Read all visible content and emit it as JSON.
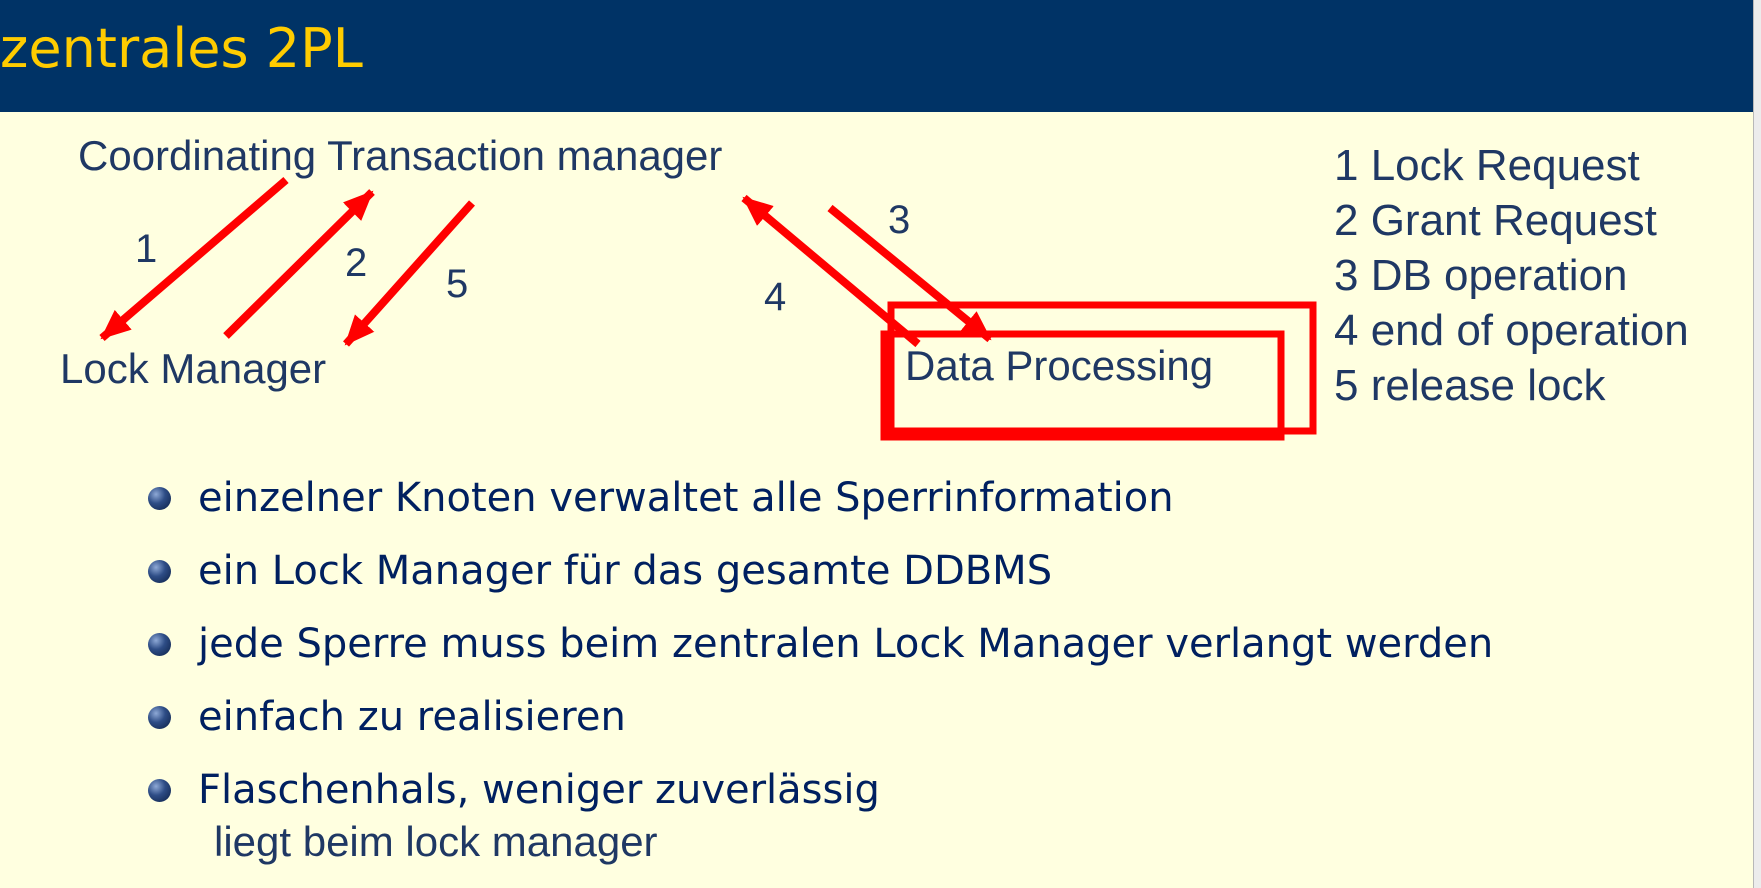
{
  "title": "zentrales 2PL",
  "diagram": {
    "nodes": {
      "coordinator": "Coordinating Transaction manager",
      "lock_manager": "Lock Manager",
      "data_processing": "Data Processing"
    },
    "arrow_labels": {
      "step1": "1",
      "step2": "2",
      "step3": "3",
      "step4": "4",
      "step5": "5"
    },
    "arrow_color": "#ff0000",
    "highlight_color": "#ff0000"
  },
  "legend": [
    "1 Lock Request",
    "2 Grant Request",
    "3 DB operation",
    "4 end of operation",
    "5 release lock"
  ],
  "bullets": [
    "einzelner Knoten verwaltet alle Sperrinformation",
    "ein Lock Manager für das gesamte DDBMS",
    "jede Sperre muss beim zentralen Lock Manager verlangt werden",
    "einfach zu realisieren",
    "Flaschenhals, weniger zuverlässig"
  ],
  "note": "liegt beim lock manager",
  "colors": {
    "title_bar": "#003366",
    "title_text": "#ffcc00",
    "background": "#ffffe0",
    "body_text": "#1f3864"
  }
}
